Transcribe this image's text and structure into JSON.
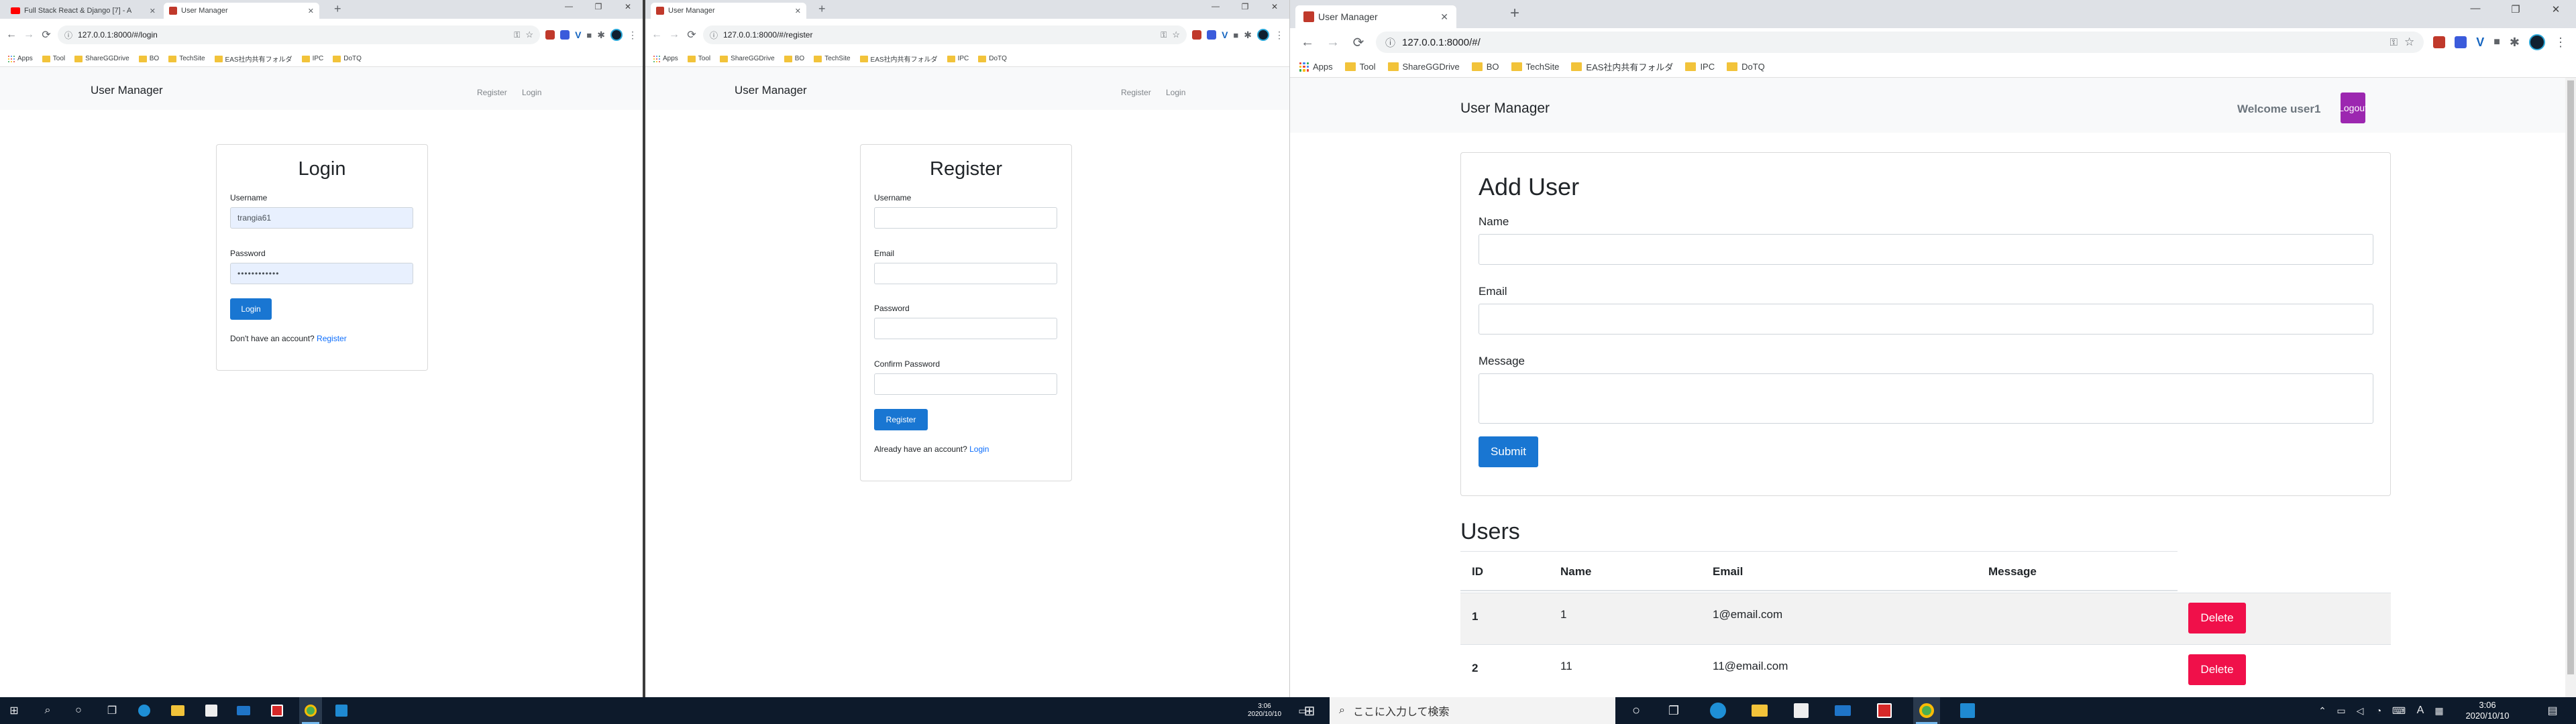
{
  "colors": {
    "chrome_tabbar": "#dee1e6",
    "navbar_bg": "#f8f9fa",
    "primary_button": "#1976d2",
    "link": "#0d6efd",
    "delete_button": "#f0104a",
    "logout_button": "#9c27b0",
    "taskbar": "#0d1a2b",
    "autofill": "#e8f0fe",
    "bookmark_folder": "#f2c33a"
  },
  "browsers": {
    "left": {
      "tabs": [
        {
          "title": "Full Stack React & Django [7] - A",
          "icon": "youtube-icon"
        },
        {
          "title": "User Manager",
          "icon": "site-icon"
        }
      ],
      "url": "127.0.0.1:8000/#/login",
      "bookmarks": [
        "Apps",
        "Tool",
        "ShareGGDrive",
        "BO",
        "TechSite",
        "EAS社内共有フォルダ",
        "IPC",
        "DoTQ"
      ],
      "brand": "User Manager",
      "nav": [
        "Register",
        "Login"
      ],
      "form": {
        "title": "Login",
        "username_label": "Username",
        "username_value": "trangia61",
        "password_label": "Password",
        "password_value": "••••••••••••",
        "submit": "Login",
        "footer_text": "Don't have an account? ",
        "footer_link": "Register"
      }
    },
    "middle": {
      "tabs": [
        {
          "title": "User Manager",
          "icon": "site-icon"
        }
      ],
      "url": "127.0.0.1:8000/#/register",
      "bookmarks": [
        "Apps",
        "Tool",
        "ShareGGDrive",
        "BO",
        "TechSite",
        "EAS社内共有フォルダ",
        "IPC",
        "DoTQ"
      ],
      "brand": "User Manager",
      "nav": [
        "Register",
        "Login"
      ],
      "form": {
        "title": "Register",
        "username_label": "Username",
        "email_label": "Email",
        "password_label": "Password",
        "confirm_label": "Confirm Password",
        "submit": "Register",
        "footer_text": "Already have an account? ",
        "footer_link": "Login"
      }
    },
    "right": {
      "tabs": [
        {
          "title": "User Manager",
          "icon": "site-icon"
        }
      ],
      "url": "127.0.0.1:8000/#/",
      "bookmarks": [
        "Apps",
        "Tool",
        "ShareGGDrive",
        "BO",
        "TechSite",
        "EAS社内共有フォルダ",
        "IPC",
        "DoTQ"
      ],
      "brand": "User Manager",
      "welcome": "Welcome user1",
      "logout": "Logout",
      "add_user": {
        "title": "Add User",
        "name_label": "Name",
        "email_label": "Email",
        "message_label": "Message",
        "submit": "Submit"
      },
      "users": {
        "title": "Users",
        "columns": [
          "ID",
          "Name",
          "Email",
          "Message"
        ],
        "rows": [
          {
            "id": "1",
            "name": "1",
            "email": "1@email.com",
            "message": "",
            "action": "Delete"
          },
          {
            "id": "2",
            "name": "11",
            "email": "11@email.com",
            "message": "",
            "action": "Delete"
          }
        ]
      }
    }
  },
  "taskbar": {
    "search_placeholder": "ここに入力して検索",
    "left_time": "3:06",
    "left_date": "2020/10/10",
    "right_time": "3:06",
    "right_date": "2020/10/10",
    "ime": "A"
  }
}
